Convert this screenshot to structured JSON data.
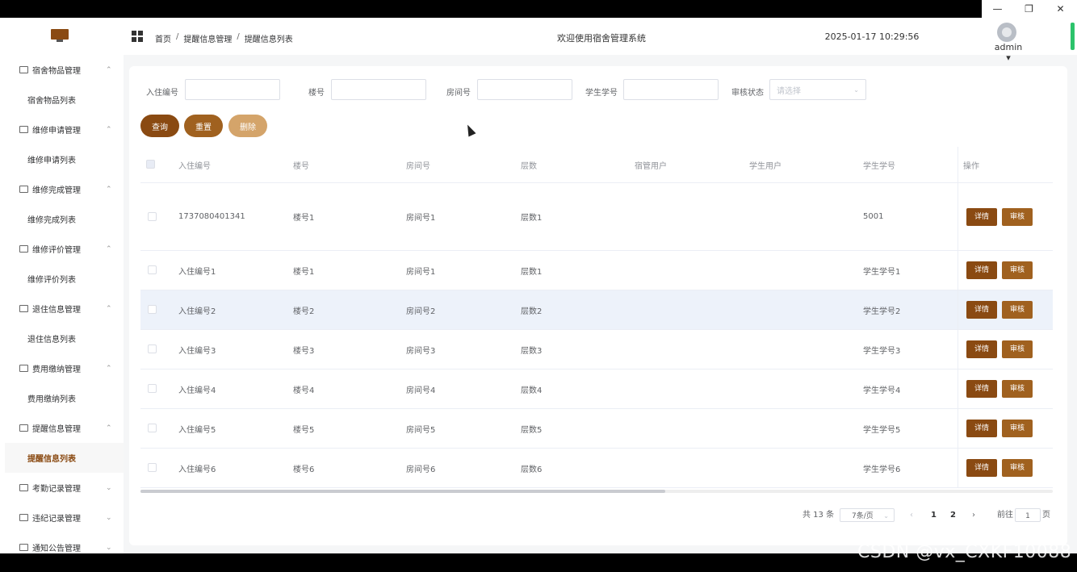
{
  "window": {
    "minimize": "—",
    "restore": "❐",
    "close": "✕"
  },
  "header": {
    "breadcrumb": [
      "首页",
      "提醒信息管理",
      "提醒信息列表"
    ],
    "breadcrumb_sep": "/",
    "welcome": "欢迎使用宿舍管理系统",
    "datetime": "2025-01-17 10:29:56",
    "user": "admin ▾"
  },
  "sidebar": {
    "groups": [
      {
        "label": "宿舍物品管理",
        "arrow": "⌃",
        "item": "宿舍物品列表"
      },
      {
        "label": "维修申请管理",
        "arrow": "⌃",
        "item": "维修申请列表"
      },
      {
        "label": "维修完成管理",
        "arrow": "⌃",
        "item": "维修完成列表"
      },
      {
        "label": "维修评价管理",
        "arrow": "⌃",
        "item": "维修评价列表"
      },
      {
        "label": "退住信息管理",
        "arrow": "⌃",
        "item": "退住信息列表"
      },
      {
        "label": "费用缴纳管理",
        "arrow": "⌃",
        "item": "费用缴纳列表"
      },
      {
        "label": "提醒信息管理",
        "arrow": "⌃",
        "item": "提醒信息列表"
      },
      {
        "label": "考勤记录管理",
        "arrow": "⌄"
      },
      {
        "label": "违纪记录管理",
        "arrow": "⌄"
      },
      {
        "label": "通知公告管理",
        "arrow": "⌄"
      }
    ]
  },
  "filters": {
    "checkin_label": "入住编号",
    "building_label": "楼号",
    "room_label": "房间号",
    "student_label": "学生学号",
    "status_label": "审核状态",
    "status_placeholder": "请选择",
    "chevron": "⌄"
  },
  "buttons": {
    "search": "查询",
    "reset": "重置",
    "delete": "删除"
  },
  "colors": {
    "search": "#8a4a12",
    "reset": "#a0611f",
    "delete": "#d4a46a"
  },
  "table": {
    "headers": [
      "入住编号",
      "楼号",
      "房间号",
      "层数",
      "宿管用户",
      "学生用户",
      "学生学号",
      "操作"
    ],
    "op_detail": "详情",
    "op_audit": "审核",
    "rows": [
      {
        "checkin": "1737080401341",
        "building": "楼号1",
        "room": "房间号1",
        "floor": "层数1",
        "manager": "",
        "student_user": "",
        "student_no": "5001"
      },
      {
        "checkin": "入住编号1",
        "building": "楼号1",
        "room": "房间号1",
        "floor": "层数1",
        "manager": "",
        "student_user": "",
        "student_no": "学生学号1"
      },
      {
        "checkin": "入住编号2",
        "building": "楼号2",
        "room": "房间号2",
        "floor": "层数2",
        "manager": "",
        "student_user": "",
        "student_no": "学生学号2"
      },
      {
        "checkin": "入住编号3",
        "building": "楼号3",
        "room": "房间号3",
        "floor": "层数3",
        "manager": "",
        "student_user": "",
        "student_no": "学生学号3"
      },
      {
        "checkin": "入住编号4",
        "building": "楼号4",
        "room": "房间号4",
        "floor": "层数4",
        "manager": "",
        "student_user": "",
        "student_no": "学生学号4"
      },
      {
        "checkin": "入住编号5",
        "building": "楼号5",
        "room": "房间号5",
        "floor": "层数5",
        "manager": "",
        "student_user": "",
        "student_no": "学生学号5"
      },
      {
        "checkin": "入住编号6",
        "building": "楼号6",
        "room": "房间号6",
        "floor": "层数6",
        "manager": "",
        "student_user": "",
        "student_no": "学生学号6"
      }
    ]
  },
  "pagination": {
    "total": "共 13 条",
    "page_size": "7条/页",
    "prev": "‹",
    "page1": "1",
    "page2": "2",
    "next": "›",
    "goto_label": "前往",
    "goto_value": "1",
    "goto_unit": "页"
  },
  "watermark": "CSDN @vx_CXKF10088"
}
